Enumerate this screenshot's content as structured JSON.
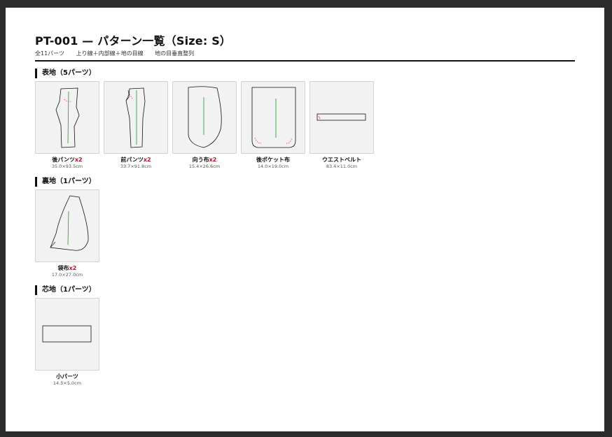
{
  "document": {
    "title": "PT-001 — パターン一覧（Size: S）",
    "subtitle": {
      "total": "全11パーツ",
      "lines": "上り線＋内部線＋地の目線",
      "grain": "地の目垂直整列"
    }
  },
  "sections": [
    {
      "heading": "表地（5パーツ）",
      "pieces": [
        {
          "name": "後パンツ",
          "qty": "x2",
          "dims": "35.0×93.5cm",
          "shape": "back-pants-icon"
        },
        {
          "name": "前パンツ",
          "qty": "x2",
          "dims": "33.7×91.8cm",
          "shape": "front-pants-icon"
        },
        {
          "name": "向う布",
          "qty": "x2",
          "dims": "15.4×26.6cm",
          "shape": "facing-icon"
        },
        {
          "name": "後ポケット布",
          "qty": "",
          "dims": "14.0×19.0cm",
          "shape": "back-pocket-icon"
        },
        {
          "name": "ウエストベルト",
          "qty": "",
          "dims": "83.4×11.0cm",
          "shape": "waistband-icon"
        }
      ]
    },
    {
      "heading": "裏地（1パーツ）",
      "pieces": [
        {
          "name": "袋布",
          "qty": "x2",
          "dims": "17.0×27.0cm",
          "shape": "pocket-bag-icon"
        }
      ]
    },
    {
      "heading": "芯地（1パーツ）",
      "pieces": [
        {
          "name": "小パーツ",
          "qty": "",
          "dims": "14.5×5.0cm",
          "shape": "small-part-icon"
        }
      ]
    }
  ],
  "colors": {
    "outline": "#111111",
    "grainline": "#1a9a2a",
    "internal": "#d0302a",
    "quantity": "#c0102a",
    "card_bg": "#f2f2f2"
  }
}
